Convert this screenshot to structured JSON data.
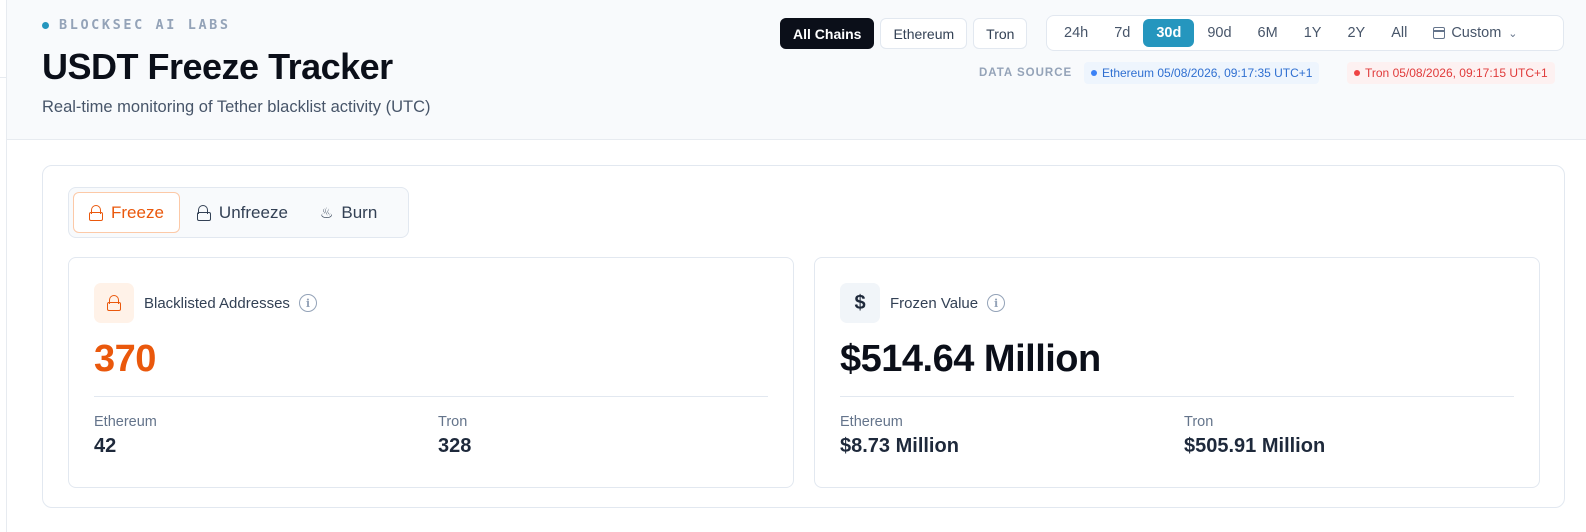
{
  "brand": {
    "label": "BLOCKSEC AI LABS"
  },
  "header": {
    "title": "USDT Freeze Tracker",
    "subtitle": "Real-time monitoring of Tether blacklist activity (UTC)"
  },
  "chains": [
    {
      "label": "All Chains",
      "active": true
    },
    {
      "label": "Ethereum",
      "active": false
    },
    {
      "label": "Tron",
      "active": false
    }
  ],
  "ranges": [
    {
      "label": "24h",
      "active": false
    },
    {
      "label": "7d",
      "active": false
    },
    {
      "label": "30d",
      "active": true
    },
    {
      "label": "90d",
      "active": false
    },
    {
      "label": "6M",
      "active": false
    },
    {
      "label": "1Y",
      "active": false
    },
    {
      "label": "2Y",
      "active": false
    },
    {
      "label": "All",
      "active": false
    }
  ],
  "custom": {
    "label": "Custom",
    "icon": "calendar-icon"
  },
  "data_source": {
    "label": "DATA SOURCE",
    "ethereum": "Ethereum 05/08/2026, 09:17:35 UTC+1",
    "tron": "Tron 05/08/2026, 09:17:15 UTC+1"
  },
  "tabs": [
    {
      "label": "Freeze",
      "icon": "lock-icon",
      "active": true
    },
    {
      "label": "Unfreeze",
      "icon": "unlock-icon",
      "active": false
    },
    {
      "label": "Burn",
      "icon": "flame-icon",
      "active": false
    }
  ],
  "cards": {
    "blacklisted": {
      "label": "Blacklisted Addresses",
      "value": "370",
      "eth_label": "Ethereum",
      "eth_value": "42",
      "tron_label": "Tron",
      "tron_value": "328"
    },
    "frozen": {
      "label": "Frozen Value",
      "icon_glyph": "$",
      "value": "$514.64 Million",
      "eth_label": "Ethereum",
      "eth_value": "$8.73 Million",
      "tron_label": "Tron",
      "tron_value": "$505.91 Million"
    }
  },
  "colors": {
    "accent_blue": "#2596be",
    "freeze_orange": "#ea580c",
    "ethereum_blue": "#3b82f6",
    "tron_red": "#ef4444"
  }
}
